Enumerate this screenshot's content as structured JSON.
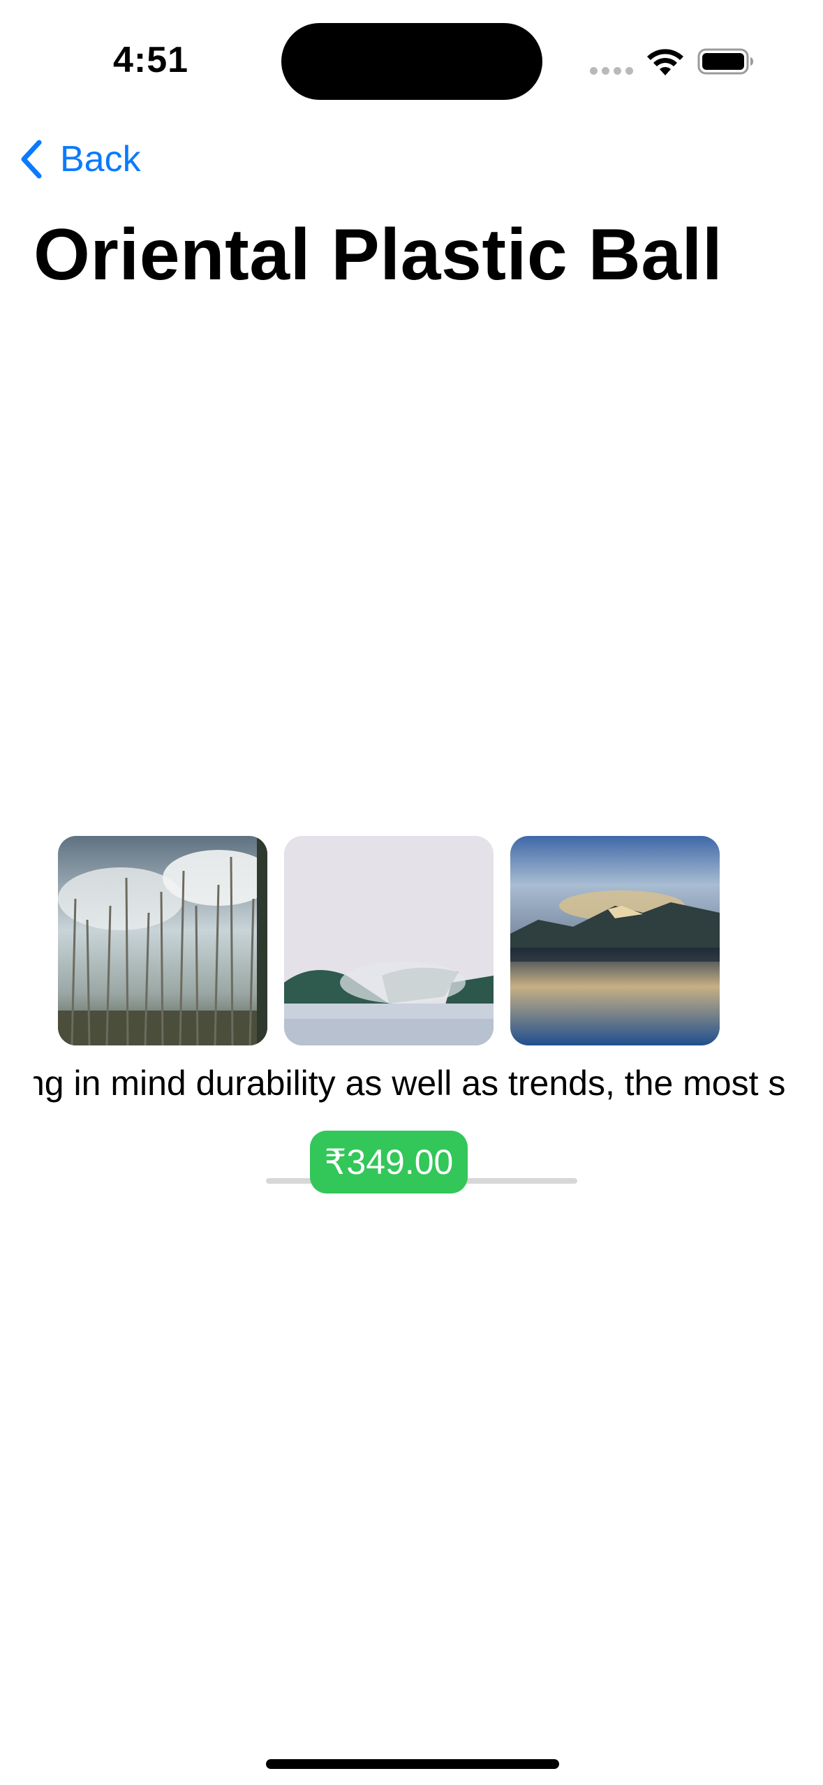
{
  "status_bar": {
    "time": "4:51",
    "icons": [
      "cellular-dots-icon",
      "wifi-icon",
      "battery-icon"
    ]
  },
  "nav": {
    "back_label": "Back",
    "back_icon": "chevron-left-icon",
    "accent_color": "#0A7AFF"
  },
  "product": {
    "title": "Oriental Plastic Ball",
    "images": [
      {
        "icon": "forest-photo"
      },
      {
        "icon": "foggy-lake-photo"
      },
      {
        "icon": "mountain-lake-photo"
      }
    ],
    "description": "ng in mind durability as well as trends, the most s",
    "price": "₹349.00",
    "price_color": "#33C659"
  }
}
